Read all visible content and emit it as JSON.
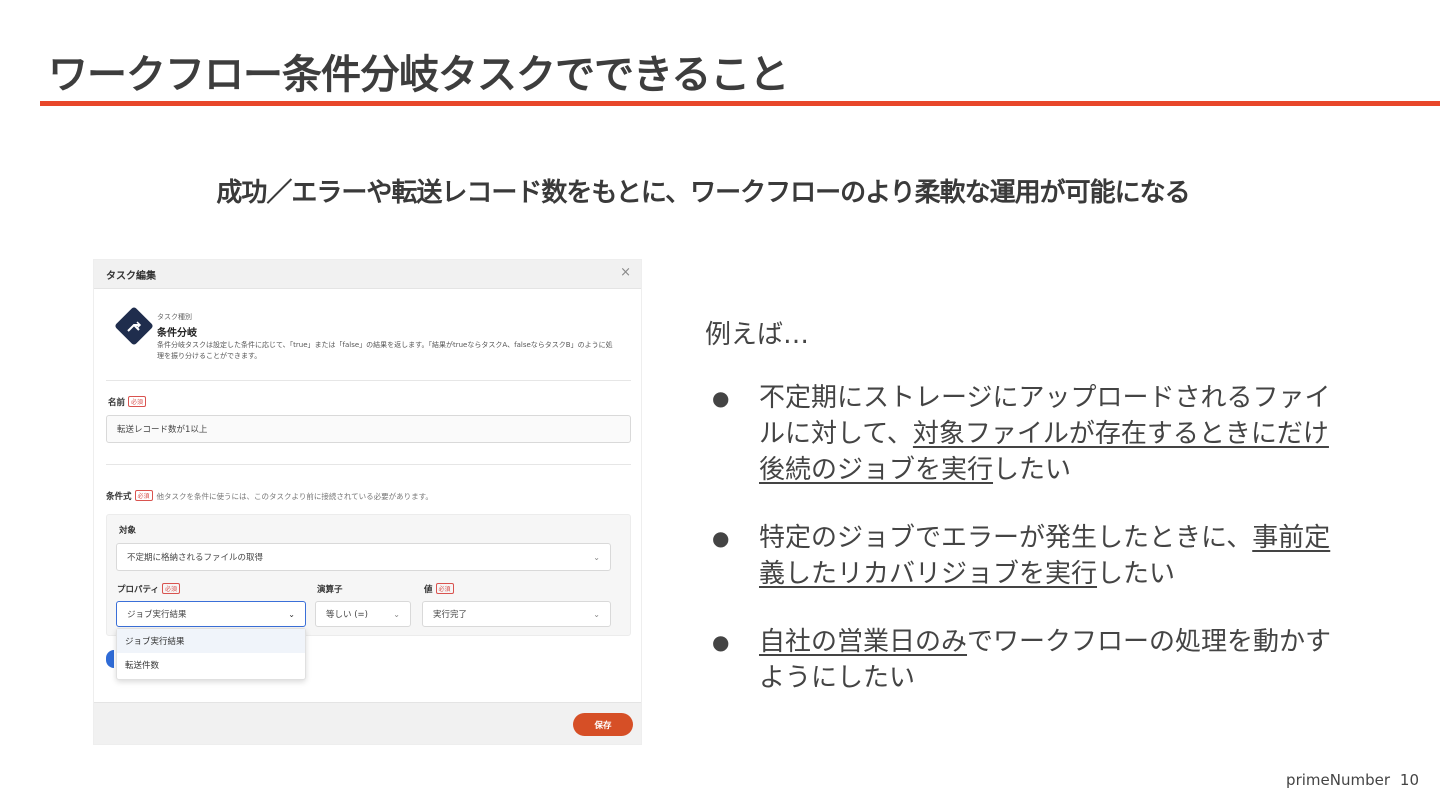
{
  "slide": {
    "title": "ワークフロー条件分岐タスクでできること",
    "subtitle": "成功／エラーや転送レコード数をもとに、ワークフローのより柔軟な運用が可能になる",
    "footer_brand": "primeNumber",
    "page_number": "10"
  },
  "dialog": {
    "title": "タスク編集",
    "close_glyph": "×",
    "task_kind_label": "タスク種別",
    "task_type_name": "条件分岐",
    "task_description": "条件分岐タスクは設定した条件に応じて、「true」または「false」の結果を返します。「結果がtrueならタスクA、falseならタスクB」のように処理を振り分けることができます。",
    "required_badge": "必須",
    "name_label": "名前",
    "name_value": "転送レコード数が1以上",
    "condition_label": "条件式",
    "condition_hint": "他タスクを条件に使うには、このタスクより前に接続されている必要があります。",
    "target_label": "対象",
    "target_value": "不定期に格納されるファイルの取得",
    "property_label": "プロパティ",
    "property_value": "ジョブ実行結果",
    "operator_label": "演算子",
    "operator_value": "等しい (=)",
    "value_label": "値",
    "value_value": "実行完了",
    "dropdown_options": [
      "ジョブ実行結果",
      "転送件数"
    ],
    "save_label": "保存",
    "chevron_icon": "chevron-down-icon",
    "accent_color": "#d64f26"
  },
  "examples": {
    "label": "例えば…",
    "items": [
      {
        "before": "不定期にストレージにアップロードされるファイルに対して、",
        "underlined": "対象ファイルが存在するときにだけ後続のジョブを実行",
        "after": "したい"
      },
      {
        "before": "特定のジョブでエラーが発生したときに、",
        "underlined": "事前定義したリカバリジョブを実行",
        "after": "したい"
      },
      {
        "before": "",
        "underlined": "自社の営業日のみ",
        "after": "でワークフローの処理を動かすようにしたい"
      }
    ]
  },
  "colors": {
    "title_rule": "#e8472a",
    "text": "#444444"
  }
}
